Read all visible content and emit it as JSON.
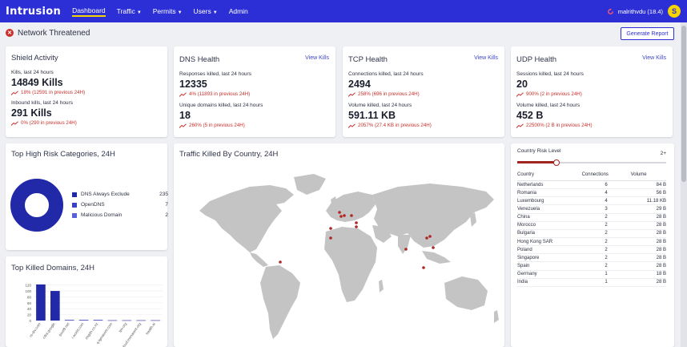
{
  "nav": {
    "logo": "Intrusion",
    "links": [
      {
        "label": "Dashboard",
        "active": true,
        "dropdown": false
      },
      {
        "label": "Traffic",
        "active": false,
        "dropdown": true
      },
      {
        "label": "Permits",
        "active": false,
        "dropdown": true
      },
      {
        "label": "Users",
        "active": false,
        "dropdown": true
      },
      {
        "label": "Admin",
        "active": false,
        "dropdown": false
      }
    ],
    "user": "malrithvdu (18.4)",
    "avatar_letter": "S",
    "accent": "#2c2fd6",
    "highlight": "#f5d400"
  },
  "status": {
    "text": "Network Threatened",
    "generate_button": "Generate Report",
    "color": "#c9302c"
  },
  "shield": {
    "title": "Shield Activity",
    "kills_label": "Kills, last 24 hours",
    "kills_value": "14849 Kills",
    "kills_delta": "18% (12591 in previous 24H)",
    "inbound_label": "Inbound kills, last 24 hours",
    "inbound_value": "291 Kills",
    "inbound_delta": "0% (290 in previous 24H)"
  },
  "dns": {
    "title": "DNS Health",
    "view": "View Kills",
    "l1": "Responses killed, last 24 hours",
    "v1": "12335",
    "d1": "4% (11893 in previous 24H)",
    "l2": "Unique domains killed, last 24 hours",
    "v2": "18",
    "d2": "260% (5 in previous 24H)"
  },
  "tcp": {
    "title": "TCP Health",
    "view": "View Kills",
    "l1": "Connections killed, last 24 hours",
    "v1": "2494",
    "d1": "258% (696 in previous 24H)",
    "l2": "Volume killed, last 24 hours",
    "v2": "591.11 KB",
    "d2": "2057% (27.4 KB in previous 24H)"
  },
  "udp": {
    "title": "UDP Health",
    "view": "View Kills",
    "l1": "Sessions killed, last 24 hours",
    "v1": "20",
    "d1": "900% (2 in previous 24H)",
    "l2": "Volume killed, last 24 hours",
    "v2": "452 B",
    "d2": "22500% (2 B in previous 24H)"
  },
  "categories": {
    "title": "Top High Risk Categories, 24H",
    "items": [
      {
        "label": "DNS Always Exclude",
        "value": 235,
        "color": "#2229a8"
      },
      {
        "label": "OpenDNS",
        "value": 7,
        "color": "#3a40c4"
      },
      {
        "label": "Malicious Domain",
        "value": 2,
        "color": "#5a60dc"
      }
    ]
  },
  "map": {
    "title": "Traffic Killed By Country, 24H",
    "land_color": "#c4c4c4",
    "dot_color": "#b02622"
  },
  "domains": {
    "title": "Top Killed Domains, 24H",
    "chart_data": {
      "type": "bar",
      "categories": [
        "rs-drv.com",
        "cdra.google",
        "pixel9.net",
        "i.world.com",
        "imgdn.co.nz",
        "q.tgmarent.com",
        "tpv.org",
        "cloud.trsmarent.org",
        "health.ai"
      ],
      "values": [
        122,
        100,
        2,
        2,
        2,
        1,
        1,
        1,
        1
      ],
      "y_ticks": [
        0,
        20,
        40,
        60,
        80,
        100,
        120
      ],
      "ylim": [
        0,
        130
      ],
      "bar_color": "#2229a8"
    }
  },
  "risk": {
    "title": "Country Risk Level",
    "value": "2+",
    "level_fraction": 0.26,
    "headers": {
      "country": "Country",
      "connections": "Connections",
      "volume": "Volume"
    },
    "rows": [
      {
        "country": "Netherlands",
        "connections": "6",
        "volume": "84 B"
      },
      {
        "country": "Romania",
        "connections": "4",
        "volume": "56 B"
      },
      {
        "country": "Luxembourg",
        "connections": "4",
        "volume": "11.18 KB"
      },
      {
        "country": "Venezuela",
        "connections": "3",
        "volume": "29 B"
      },
      {
        "country": "China",
        "connections": "2",
        "volume": "28 B"
      },
      {
        "country": "Morocco",
        "connections": "2",
        "volume": "28 B"
      },
      {
        "country": "Bulgaria",
        "connections": "2",
        "volume": "28 B"
      },
      {
        "country": "Hong Kong SAR",
        "connections": "2",
        "volume": "28 B"
      },
      {
        "country": "Poland",
        "connections": "2",
        "volume": "28 B"
      },
      {
        "country": "Singapore",
        "connections": "2",
        "volume": "28 B"
      },
      {
        "country": "Spain",
        "connections": "2",
        "volume": "28 B"
      },
      {
        "country": "Germany",
        "connections": "1",
        "volume": "18 B"
      },
      {
        "country": "India",
        "connections": "1",
        "volume": "28 B"
      }
    ]
  }
}
